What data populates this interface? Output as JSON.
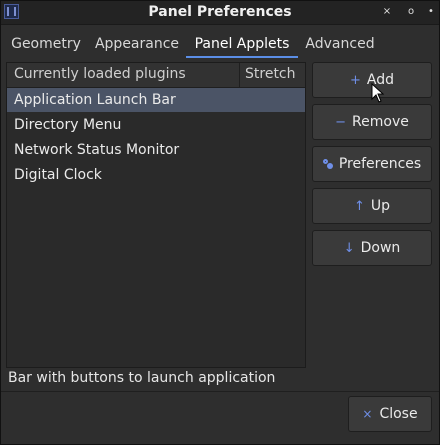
{
  "window": {
    "title": "Panel Preferences",
    "controls": {
      "close": "×",
      "maximize": "o",
      "minimize": "•"
    }
  },
  "tabs": [
    {
      "label": "Geometry"
    },
    {
      "label": "Appearance"
    },
    {
      "label": "Panel Applets",
      "active": true
    },
    {
      "label": "Advanced"
    }
  ],
  "list": {
    "header": {
      "plugins": "Currently loaded plugins",
      "stretch": "Stretch"
    },
    "rows": [
      {
        "label": "Application Launch Bar",
        "selected": true
      },
      {
        "label": "Directory Menu"
      },
      {
        "label": "Network Status Monitor"
      },
      {
        "label": "Digital Clock"
      }
    ]
  },
  "buttons": {
    "add": {
      "label": "Add",
      "icon": "+"
    },
    "remove": {
      "label": "Remove",
      "icon": "−"
    },
    "preferences": {
      "label": "Preferences",
      "icon": "preferences-icon"
    },
    "up": {
      "label": "Up",
      "icon": "↑"
    },
    "down": {
      "label": "Down",
      "icon": "↓"
    }
  },
  "status": {
    "text": "Bar with buttons to launch application"
  },
  "footer": {
    "close": {
      "label": "Close",
      "icon": "×"
    }
  },
  "colors": {
    "accent": "#5b8ee6",
    "selection": "#4b5466",
    "icon": "#6f8fe8"
  }
}
